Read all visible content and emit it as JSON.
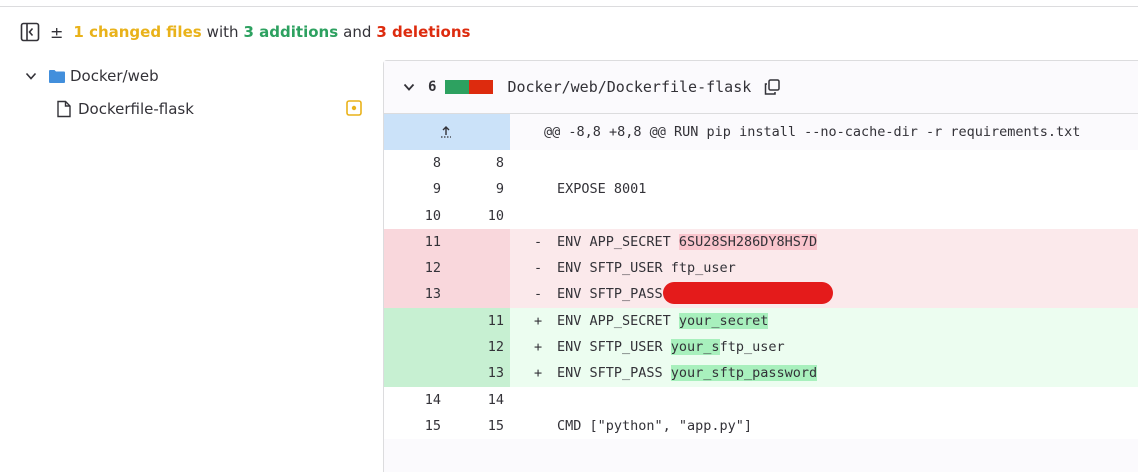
{
  "summary": {
    "changed": "1 changed files",
    "with": "with",
    "additions": "3 additions",
    "and": "and",
    "deletions": "3 deletions"
  },
  "tree": {
    "folder": "Docker/web",
    "file": "Dockerfile-flask"
  },
  "file_header": {
    "count": "6",
    "path": "Docker/web/Dockerfile-flask"
  },
  "hunk": "@@ -8,8 +8,8 @@ RUN pip install --no-cache-dir -r requirements.txt",
  "lines": [
    {
      "type": "ctx",
      "old": "8",
      "new": "8",
      "marker": "",
      "text": ""
    },
    {
      "type": "ctx",
      "old": "9",
      "new": "9",
      "marker": "",
      "text": "EXPOSE 8001"
    },
    {
      "type": "ctx",
      "old": "10",
      "new": "10",
      "marker": "",
      "text": ""
    },
    {
      "type": "old",
      "old": "11",
      "new": "",
      "marker": "-",
      "prefix": "ENV APP_SECRET ",
      "hl": "6SU28SH286DY8HS7D"
    },
    {
      "type": "old",
      "old": "12",
      "new": "",
      "marker": "-",
      "prefix": "ENV SFTP_USER ftp_user",
      "hl": ""
    },
    {
      "type": "old",
      "old": "13",
      "new": "",
      "marker": "-",
      "prefix": "ENV SFTP_PASS",
      "hl": ""
    },
    {
      "type": "new",
      "old": "",
      "new": "11",
      "marker": "+",
      "prefix": "ENV APP_SECRET ",
      "hl": "your_secret"
    },
    {
      "type": "new",
      "old": "",
      "new": "12",
      "marker": "+",
      "prefix": "ENV SFTP_USER ",
      "hl": "your_s",
      "suffix": "ftp_user"
    },
    {
      "type": "new",
      "old": "",
      "new": "13",
      "marker": "+",
      "prefix": "ENV SFTP_PASS ",
      "hl": "your_sftp_password"
    },
    {
      "type": "ctx",
      "old": "14",
      "new": "14",
      "marker": "",
      "text": ""
    },
    {
      "type": "ctx",
      "old": "15",
      "new": "15",
      "marker": "",
      "text": "CMD [\"python\", \"app.py\"]"
    }
  ],
  "colors": {
    "changed": "#e9b21a",
    "additions": "#2da160",
    "deletions": "#dd2b0e",
    "folder": "#428fdc",
    "hunk_gutter": "#cbe2f9",
    "redaction": "#e41b1b"
  },
  "icons": {
    "toggle": "sidebar-toggle-icon",
    "expand": "expand-icon",
    "folder_chevron": "chevron-down-icon",
    "folder": "folder-icon",
    "file": "file-icon",
    "modified": "file-modified-icon",
    "collapse": "chevron-down-icon",
    "copy": "copy-icon"
  }
}
